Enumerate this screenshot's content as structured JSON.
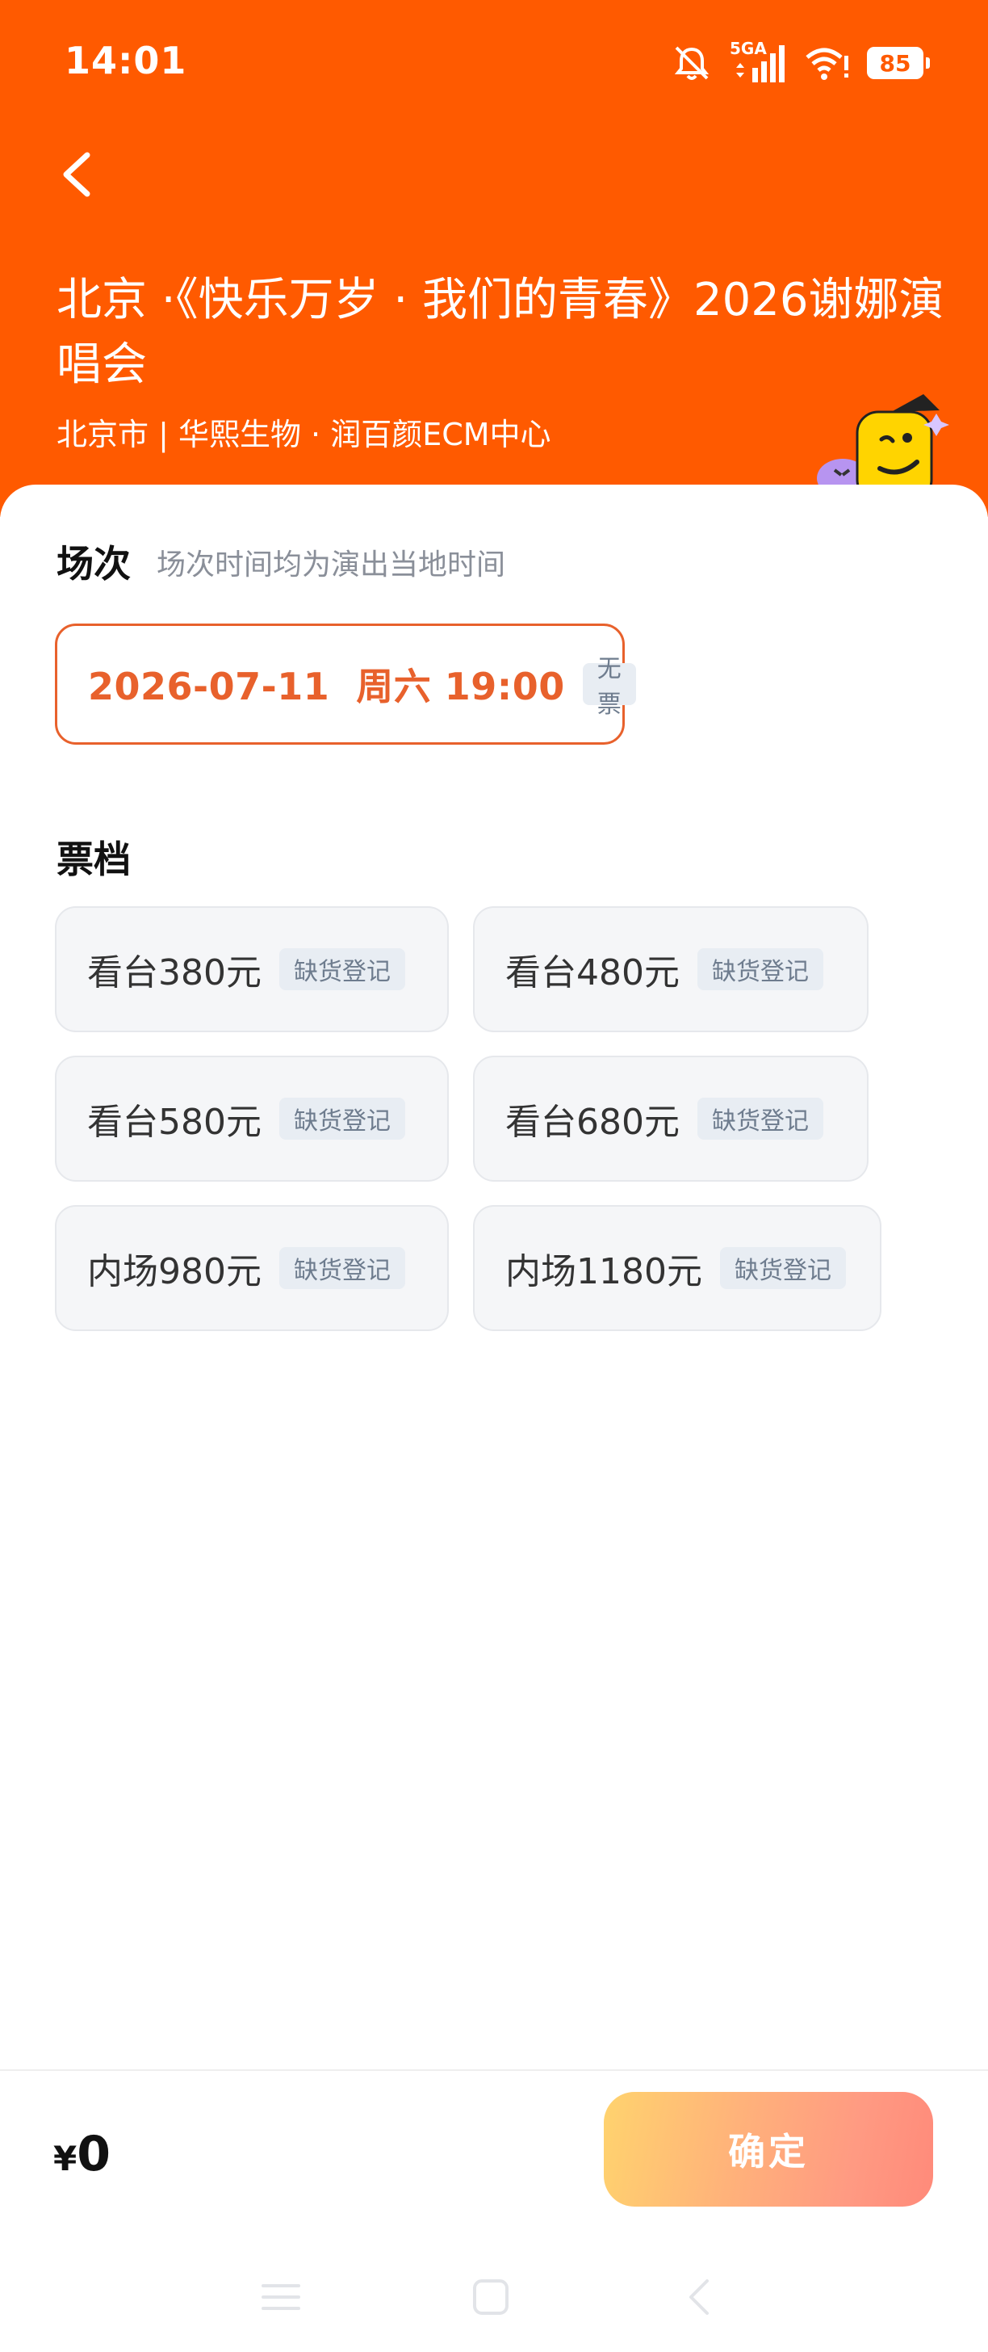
{
  "status_bar": {
    "time": "14:01",
    "network": "5GA",
    "battery": "85"
  },
  "header": {
    "title": "北京 ·《快乐万岁 · 我们的青春》2026谢娜演唱会",
    "subtitle": "北京市 | 华熙生物 · 润百颜ECM中心"
  },
  "session_section": {
    "title": "场次",
    "hint": "场次时间均为演出当地时间",
    "selected": {
      "label": "2026-07-11  周六 19:00",
      "tag": "无票"
    }
  },
  "ticket_section": {
    "title": "票档",
    "items": [
      {
        "label": "看台380元",
        "tag": "缺货登记"
      },
      {
        "label": "看台480元",
        "tag": "缺货登记"
      },
      {
        "label": "看台580元",
        "tag": "缺货登记"
      },
      {
        "label": "看台680元",
        "tag": "缺货登记"
      },
      {
        "label": "内场980元",
        "tag": "缺货登记"
      },
      {
        "label": "内场1180元",
        "tag": "缺货登记"
      }
    ]
  },
  "footer": {
    "currency": "¥",
    "amount": "0",
    "confirm_label": "确定"
  },
  "colors": {
    "header": "#ff5a00",
    "accent": "#e8612c",
    "tag_bg": "#e8edf3"
  }
}
